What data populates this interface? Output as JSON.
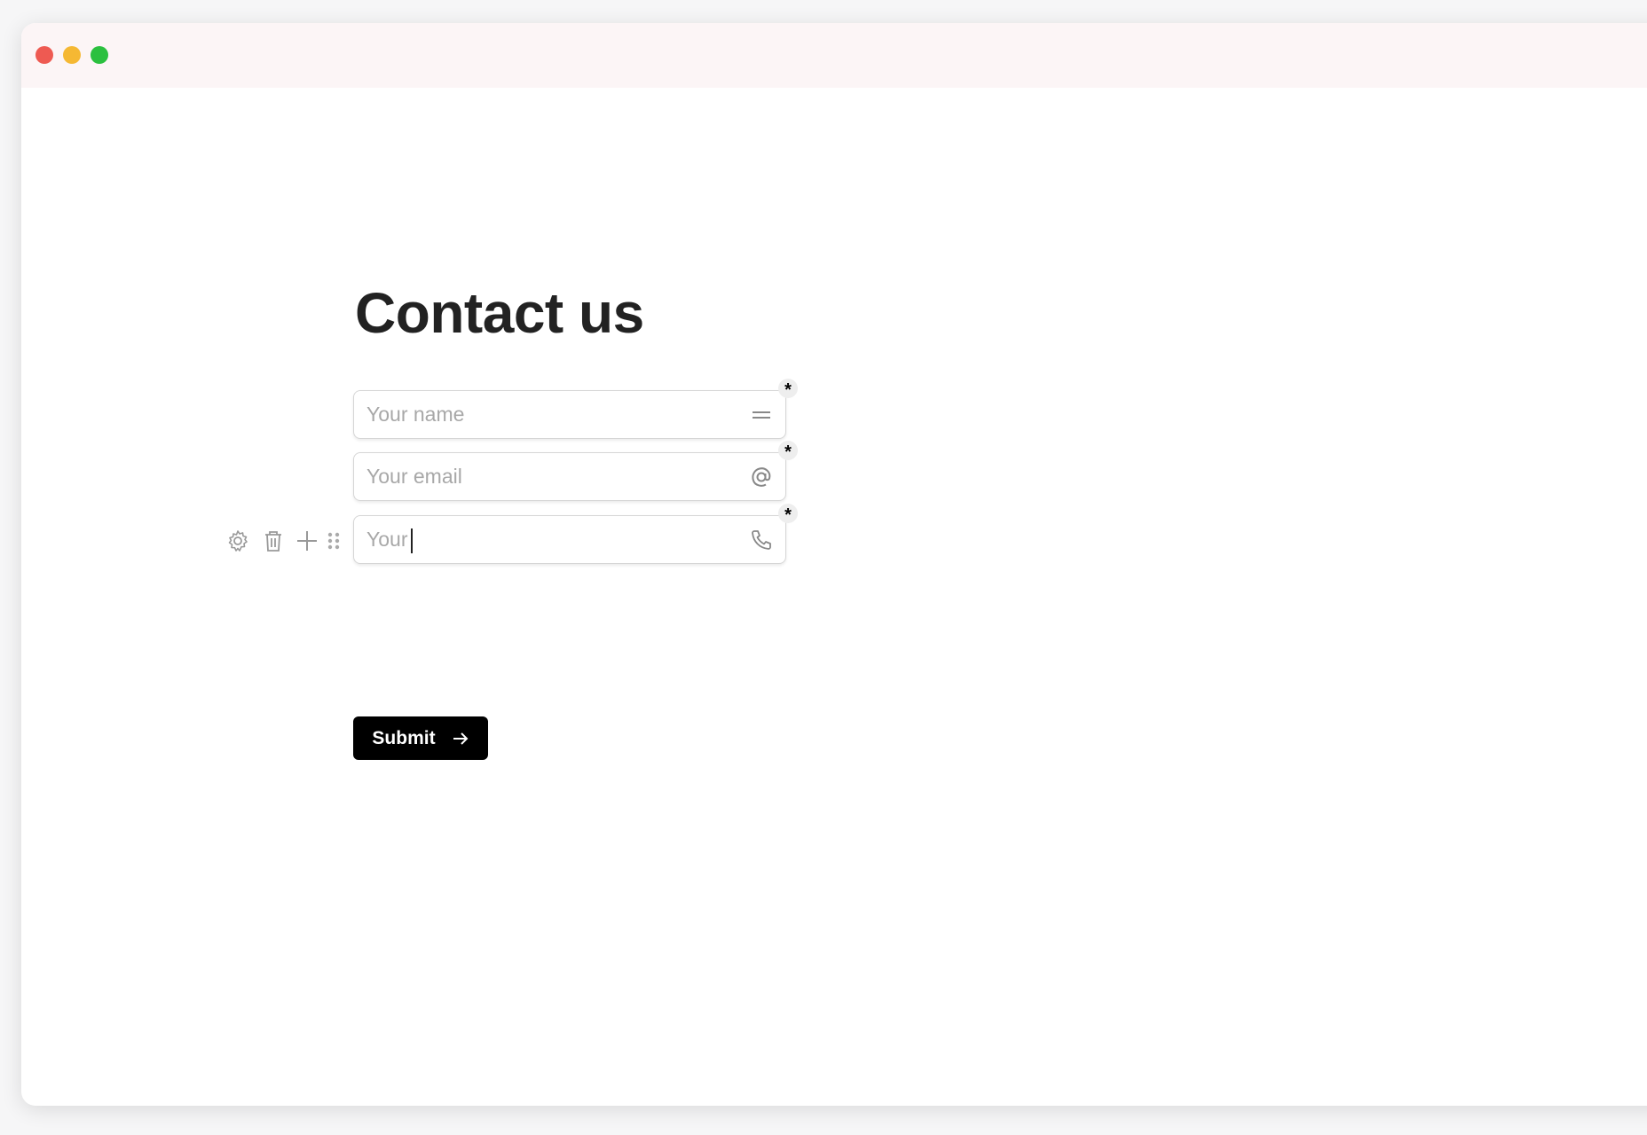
{
  "window": {
    "traffic_lights": {
      "close": "#ee5a52",
      "minimize": "#f5b833",
      "maximize": "#2bc03f"
    }
  },
  "form": {
    "title": "Contact us",
    "fields": [
      {
        "placeholder": "Your name",
        "value": "",
        "icon": "text-lines-icon",
        "required_mark": "*"
      },
      {
        "placeholder": "Your email",
        "value": "",
        "icon": "at-icon",
        "required_mark": "*"
      },
      {
        "placeholder": "",
        "value": "Your",
        "icon": "phone-icon",
        "required_mark": "*"
      }
    ],
    "field_toolbar": [
      "gear-icon",
      "trash-icon",
      "plus-icon",
      "drag-handle-icon"
    ],
    "submit_label": "Submit",
    "accent": "#000000"
  }
}
